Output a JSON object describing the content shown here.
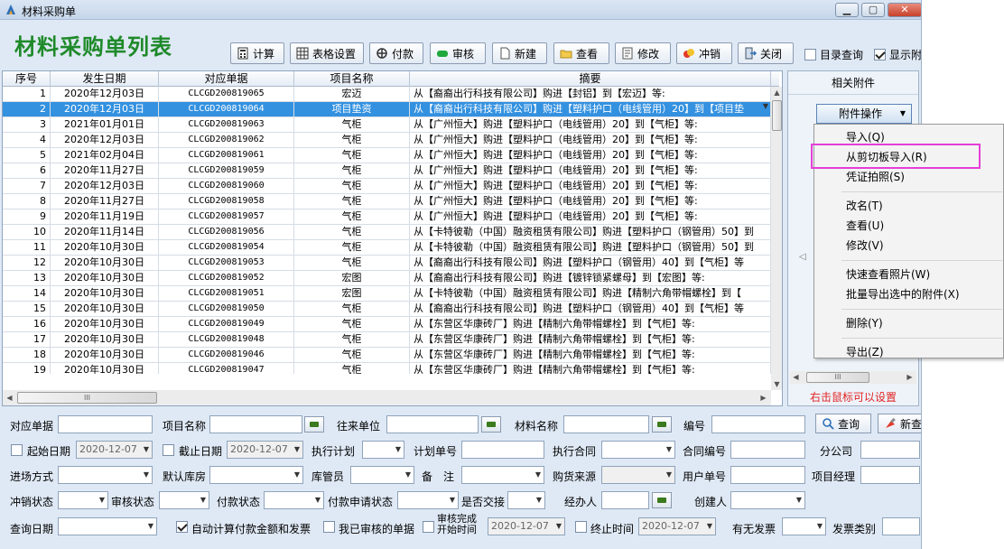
{
  "window": {
    "title": "材料采购单"
  },
  "page": {
    "heading": "材料采购单列表"
  },
  "toolbar": [
    {
      "label": "计算",
      "icon": "calculator-icon"
    },
    {
      "label": "表格设置",
      "icon": "grid-settings-icon"
    },
    {
      "label": "付款",
      "icon": "payment-icon"
    },
    {
      "label": "审核",
      "icon": "approve-icon"
    },
    {
      "label": "新建",
      "icon": "new-document-icon"
    },
    {
      "label": "查看",
      "icon": "folder-open-icon"
    },
    {
      "label": "修改",
      "icon": "edit-icon"
    },
    {
      "label": "冲销",
      "icon": "reverse-icon"
    },
    {
      "label": "关闭",
      "icon": "exit-icon"
    }
  ],
  "header_checks": [
    {
      "label": "目录查询",
      "checked": false
    },
    {
      "label": "显示附",
      "checked": true
    }
  ],
  "grid": {
    "columns": [
      "序号",
      "发生日期",
      "对应单据",
      "项目名称",
      "摘要"
    ],
    "selected_index": 1,
    "rows": [
      [
        "1",
        "2020年12月03日",
        "CLCGD200819065",
        "宏迈",
        "从【裔裔出行科技有限公司】购进【封铝】到【宏迈】等:"
      ],
      [
        "2",
        "2020年12月03日",
        "CLCGD200819064",
        "项目垫资",
        "从【裔裔出行科技有限公司】购进【塑料护口（电线管用）20】到【项目垫"
      ],
      [
        "3",
        "2021年01月01日",
        "CLCGD200819063",
        "气柜",
        "从【广州恒大】购进【塑料护口（电线管用）20】到【气柜】等:"
      ],
      [
        "4",
        "2020年12月03日",
        "CLCGD200819062",
        "气柜",
        "从【广州恒大】购进【塑料护口（电线管用）20】到【气柜】等:"
      ],
      [
        "5",
        "2021年02月04日",
        "CLCGD200819061",
        "气柜",
        "从【广州恒大】购进【塑料护口（电线管用）20】到【气柜】等:"
      ],
      [
        "6",
        "2020年11月27日",
        "CLCGD200819059",
        "气柜",
        "从【广州恒大】购进【塑料护口（电线管用）20】到【气柜】等:"
      ],
      [
        "7",
        "2020年12月03日",
        "CLCGD200819060",
        "气柜",
        "从【广州恒大】购进【塑料护口（电线管用）20】到【气柜】等:"
      ],
      [
        "8",
        "2020年11月27日",
        "CLCGD200819058",
        "气柜",
        "从【广州恒大】购进【塑料护口（电线管用）20】到【气柜】等:"
      ],
      [
        "9",
        "2020年11月19日",
        "CLCGD200819057",
        "气柜",
        "从【广州恒大】购进【塑料护口（电线管用）20】到【气柜】等:"
      ],
      [
        "10",
        "2020年11月14日",
        "CLCGD200819056",
        "气柜",
        "从【卡特彼勒（中国）融资租赁有限公司】购进【塑料护口（钢管用）50】到"
      ],
      [
        "11",
        "2020年10月30日",
        "CLCGD200819054",
        "气柜",
        "从【卡特彼勒（中国）融资租赁有限公司】购进【塑料护口（钢管用）50】到"
      ],
      [
        "12",
        "2020年10月30日",
        "CLCGD200819053",
        "气柜",
        "从【裔裔出行科技有限公司】购进【塑料护口（钢管用）40】到【气柜】等"
      ],
      [
        "13",
        "2020年10月30日",
        "CLCGD200819052",
        "宏图",
        "从【裔裔出行科技有限公司】购进【镀锌锁紧螺母】到【宏图】等:"
      ],
      [
        "14",
        "2020年10月30日",
        "CLCGD200819051",
        "宏图",
        "从【卡特彼勒（中国）融资租赁有限公司】购进【精制六角带帽螺栓】到【"
      ],
      [
        "15",
        "2020年10月30日",
        "CLCGD200819050",
        "气柜",
        "从【裔裔出行科技有限公司】购进【塑料护口（钢管用）40】到【气柜】等"
      ],
      [
        "16",
        "2020年10月30日",
        "CLCGD200819049",
        "气柜",
        "从【东营区华康砖厂】购进【精制六角带帽螺栓】到【气柜】等:"
      ],
      [
        "17",
        "2020年10月30日",
        "CLCGD200819048",
        "气柜",
        "从【东营区华康砖厂】购进【精制六角带帽螺栓】到【气柜】等:"
      ],
      [
        "18",
        "2020年10月30日",
        "CLCGD200819046",
        "气柜",
        "从【东营区华康砖厂】购进【精制六角带帽螺栓】到【气柜】等:"
      ],
      [
        "19",
        "2020年10月30日",
        "CLCGD200819047",
        "气柜",
        "从【东营区华康砖厂】购进【精制六角带帽螺栓】到【气柜】等:"
      ]
    ]
  },
  "scroll": {
    "hthumb": "III"
  },
  "attach": {
    "title": "相关附件",
    "button": "附件操作",
    "hint": "右击鼠标可以设置",
    "scroll_grip": "III",
    "nav_arrow": "◁"
  },
  "menu": {
    "items": [
      {
        "label": "导入(Q)",
        "group": 0
      },
      {
        "label": "从剪切板导入(R)",
        "group": 0,
        "highlighted": true
      },
      {
        "label": "凭证拍照(S)",
        "group": 0
      },
      {
        "label": "改名(T)",
        "group": 1
      },
      {
        "label": "查看(U)",
        "group": 1
      },
      {
        "label": "修改(V)",
        "group": 1
      },
      {
        "label": "快速查看照片(W)",
        "group": 2
      },
      {
        "label": "批量导出选中的附件(X)",
        "group": 2
      },
      {
        "label": "删除(Y)",
        "group": 3
      },
      {
        "label": "导出(Z)",
        "group": 4
      }
    ]
  },
  "filters": {
    "row1": {
      "doc": "对应单据",
      "project": "项目名称",
      "partner": "往来单位",
      "material": "材料名称",
      "code": "编号",
      "query_btn": "查询",
      "new_btn": "新查"
    },
    "row2": {
      "start_date": "起始日期",
      "start_val": "2020-12-07",
      "end_date": "截止日期",
      "end_val": "2020-12-07",
      "plan": "执行计划",
      "plan_no": "计划单号",
      "contract": "执行合同",
      "contract_no": "合同编号",
      "branch": "分公司"
    },
    "row3": {
      "entry": "进场方式",
      "warehouse": "默认库房",
      "keeper": "库管员",
      "remark": "备　注",
      "source": "购货来源",
      "user_no": "用户单号",
      "pm": "项目经理"
    },
    "row4": {
      "reverse": "冲销状态",
      "audit": "审核状态",
      "pay": "付款状态",
      "pay_req": "付款申请状态",
      "handover": "是否交接",
      "handler": "经办人",
      "creator": "创建人"
    },
    "row5": {
      "query_date": "查询日期",
      "auto_calc": "自动计算付款金额和发票",
      "my_audit": "我已审核的单据",
      "audit_done": "审核完成",
      "audit_start": "开始时间",
      "audit_val": "2020-12-07",
      "end_time": "终止时间",
      "end_time_val": "2020-12-07",
      "invoice": "有无发票",
      "invoice_type": "发票类别"
    }
  },
  "colors": {
    "heading": "#1f8a2a",
    "selection": "#3391e0",
    "hint": "#e02424",
    "menu_highlight": "#e63ed6"
  }
}
